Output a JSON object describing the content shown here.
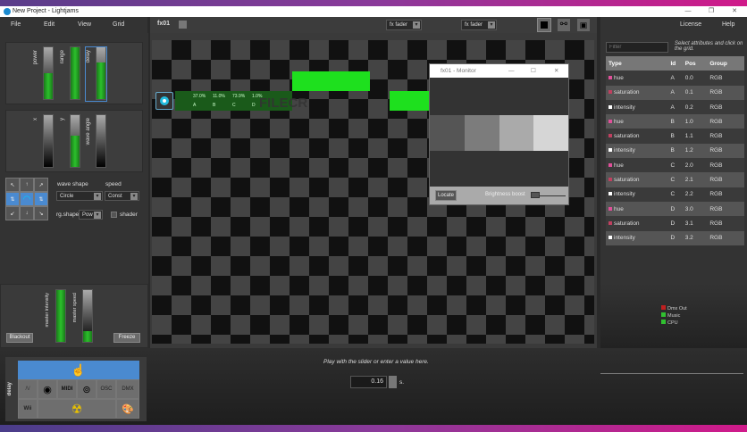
{
  "window": {
    "title": "New Project - Lightjams",
    "minimize": "—",
    "maximize": "❐",
    "close": "✕"
  },
  "menu": [
    "File",
    "Edit",
    "View",
    "Grid"
  ],
  "right_menu": [
    "License",
    "Help"
  ],
  "toolbar": {
    "tab": "fx01",
    "fader1": "fx fader",
    "fader2": "fx fader"
  },
  "faders_top": [
    {
      "label": "power",
      "value": 0.5
    },
    {
      "label": "range",
      "value": 1.0
    },
    {
      "label": "delay",
      "value": 0.7
    }
  ],
  "faders_mid": [
    {
      "label": "x",
      "value": 0
    },
    {
      "label": "y",
      "value": 0.6
    },
    {
      "label": "wave angle",
      "value": 0
    }
  ],
  "wave": {
    "shape_label": "wave shape",
    "shape": "Circle",
    "speed_label": "speed",
    "speed": "Const",
    "rg_label": "rg.shape",
    "rg": "Pow",
    "shader": "shader"
  },
  "master": {
    "intensity_label": "master intensity",
    "intensity": 1.0,
    "speed_label": "master speed",
    "speed": 0.2,
    "blackout": "Blackout",
    "freeze": "Freeze"
  },
  "fixture": {
    "values": [
      "37.0%",
      "11.0%",
      "73.9%",
      "1.0%"
    ],
    "ids": [
      "A",
      "B",
      "C",
      "D"
    ]
  },
  "watermark": "FILECR",
  "monitor": {
    "title": "fx01 - Monitor",
    "locate": "Locate",
    "brightness": "Brightness boost",
    "swatches": [
      "#555555",
      "#7c7c7c",
      "#aaaaaa",
      "#d6d6d6"
    ]
  },
  "filter": {
    "placeholder": "Filter",
    "hint": "Select attributes and click on the grid."
  },
  "table": {
    "headers": [
      "Type",
      "Id",
      "Pos",
      "Group"
    ],
    "rows": [
      [
        "hue",
        "A",
        "0.0",
        "RGB"
      ],
      [
        "saturation",
        "A",
        "0.1",
        "RGB"
      ],
      [
        "intensity",
        "A",
        "0.2",
        "RGB"
      ],
      [
        "hue",
        "B",
        "1.0",
        "RGB"
      ],
      [
        "saturation",
        "B",
        "1.1",
        "RGB"
      ],
      [
        "intensity",
        "B",
        "1.2",
        "RGB"
      ],
      [
        "hue",
        "C",
        "2.0",
        "RGB"
      ],
      [
        "saturation",
        "C",
        "2.1",
        "RGB"
      ],
      [
        "intensity",
        "C",
        "2.2",
        "RGB"
      ],
      [
        "hue",
        "D",
        "3.0",
        "RGB"
      ],
      [
        "saturation",
        "D",
        "3.1",
        "RGB"
      ],
      [
        "intensity",
        "D",
        "3.2",
        "RGB"
      ]
    ]
  },
  "type_colors": {
    "hue": "#e0509a",
    "saturation": "#c04060",
    "intensity": "#ffffff"
  },
  "status": [
    {
      "label": "Dmx Out",
      "color": "#c02020"
    },
    {
      "label": "Music",
      "color": "#30c030"
    },
    {
      "label": "CPU",
      "color": "#30c030"
    }
  ],
  "bottom": {
    "source_label": "delay",
    "hint": "Play with the slider or enter a value here.",
    "value": "0.16",
    "unit": "s.",
    "sources": [
      "MIDI",
      "OSC",
      "DMX",
      "Wii"
    ]
  }
}
